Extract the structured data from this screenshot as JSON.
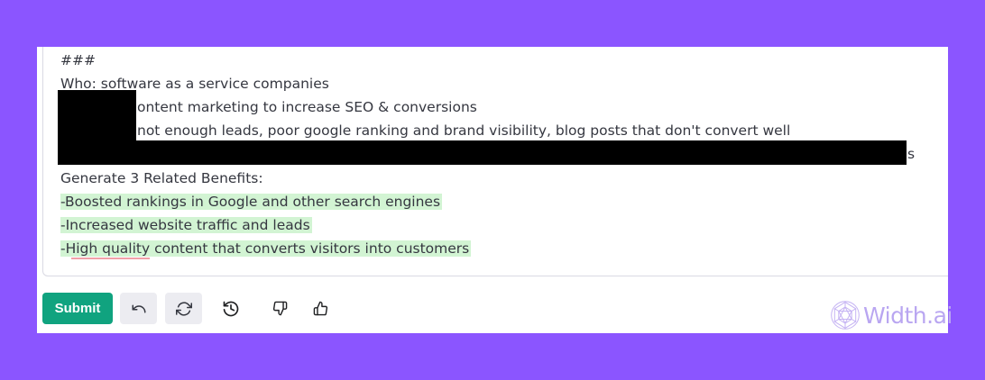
{
  "editor": {
    "line1": "###",
    "line2": "Who: software as a service companies",
    "line3": "ontent marketing to increase SEO & conversions",
    "line4": "not enough leads, poor google ranking and brand visibility, blog posts that don't convert well",
    "line5_tail": "s",
    "line6": "Generate 3 Related Benefits:",
    "benefits": [
      "-Boosted rankings in Google and other search engines",
      "-Increased website traffic and leads"
    ],
    "benefit3_pre": "-",
    "benefit3_underlined": "High quality",
    "benefit3_rest": " content that converts visitors into customers"
  },
  "toolbar": {
    "submit_label": "Submit"
  },
  "icons": {
    "undo": "undo-icon",
    "regenerate": "regenerate-icon",
    "history": "history-icon",
    "thumbs_down": "thumbs-down-icon",
    "thumbs_up": "thumbs-up-icon"
  },
  "brand": {
    "logo_text": "Width.ai"
  },
  "colors": {
    "background": "#8b55ff",
    "highlight": "#d2f4d3",
    "submit": "#10a37f",
    "logo": "#b9a6f1"
  }
}
